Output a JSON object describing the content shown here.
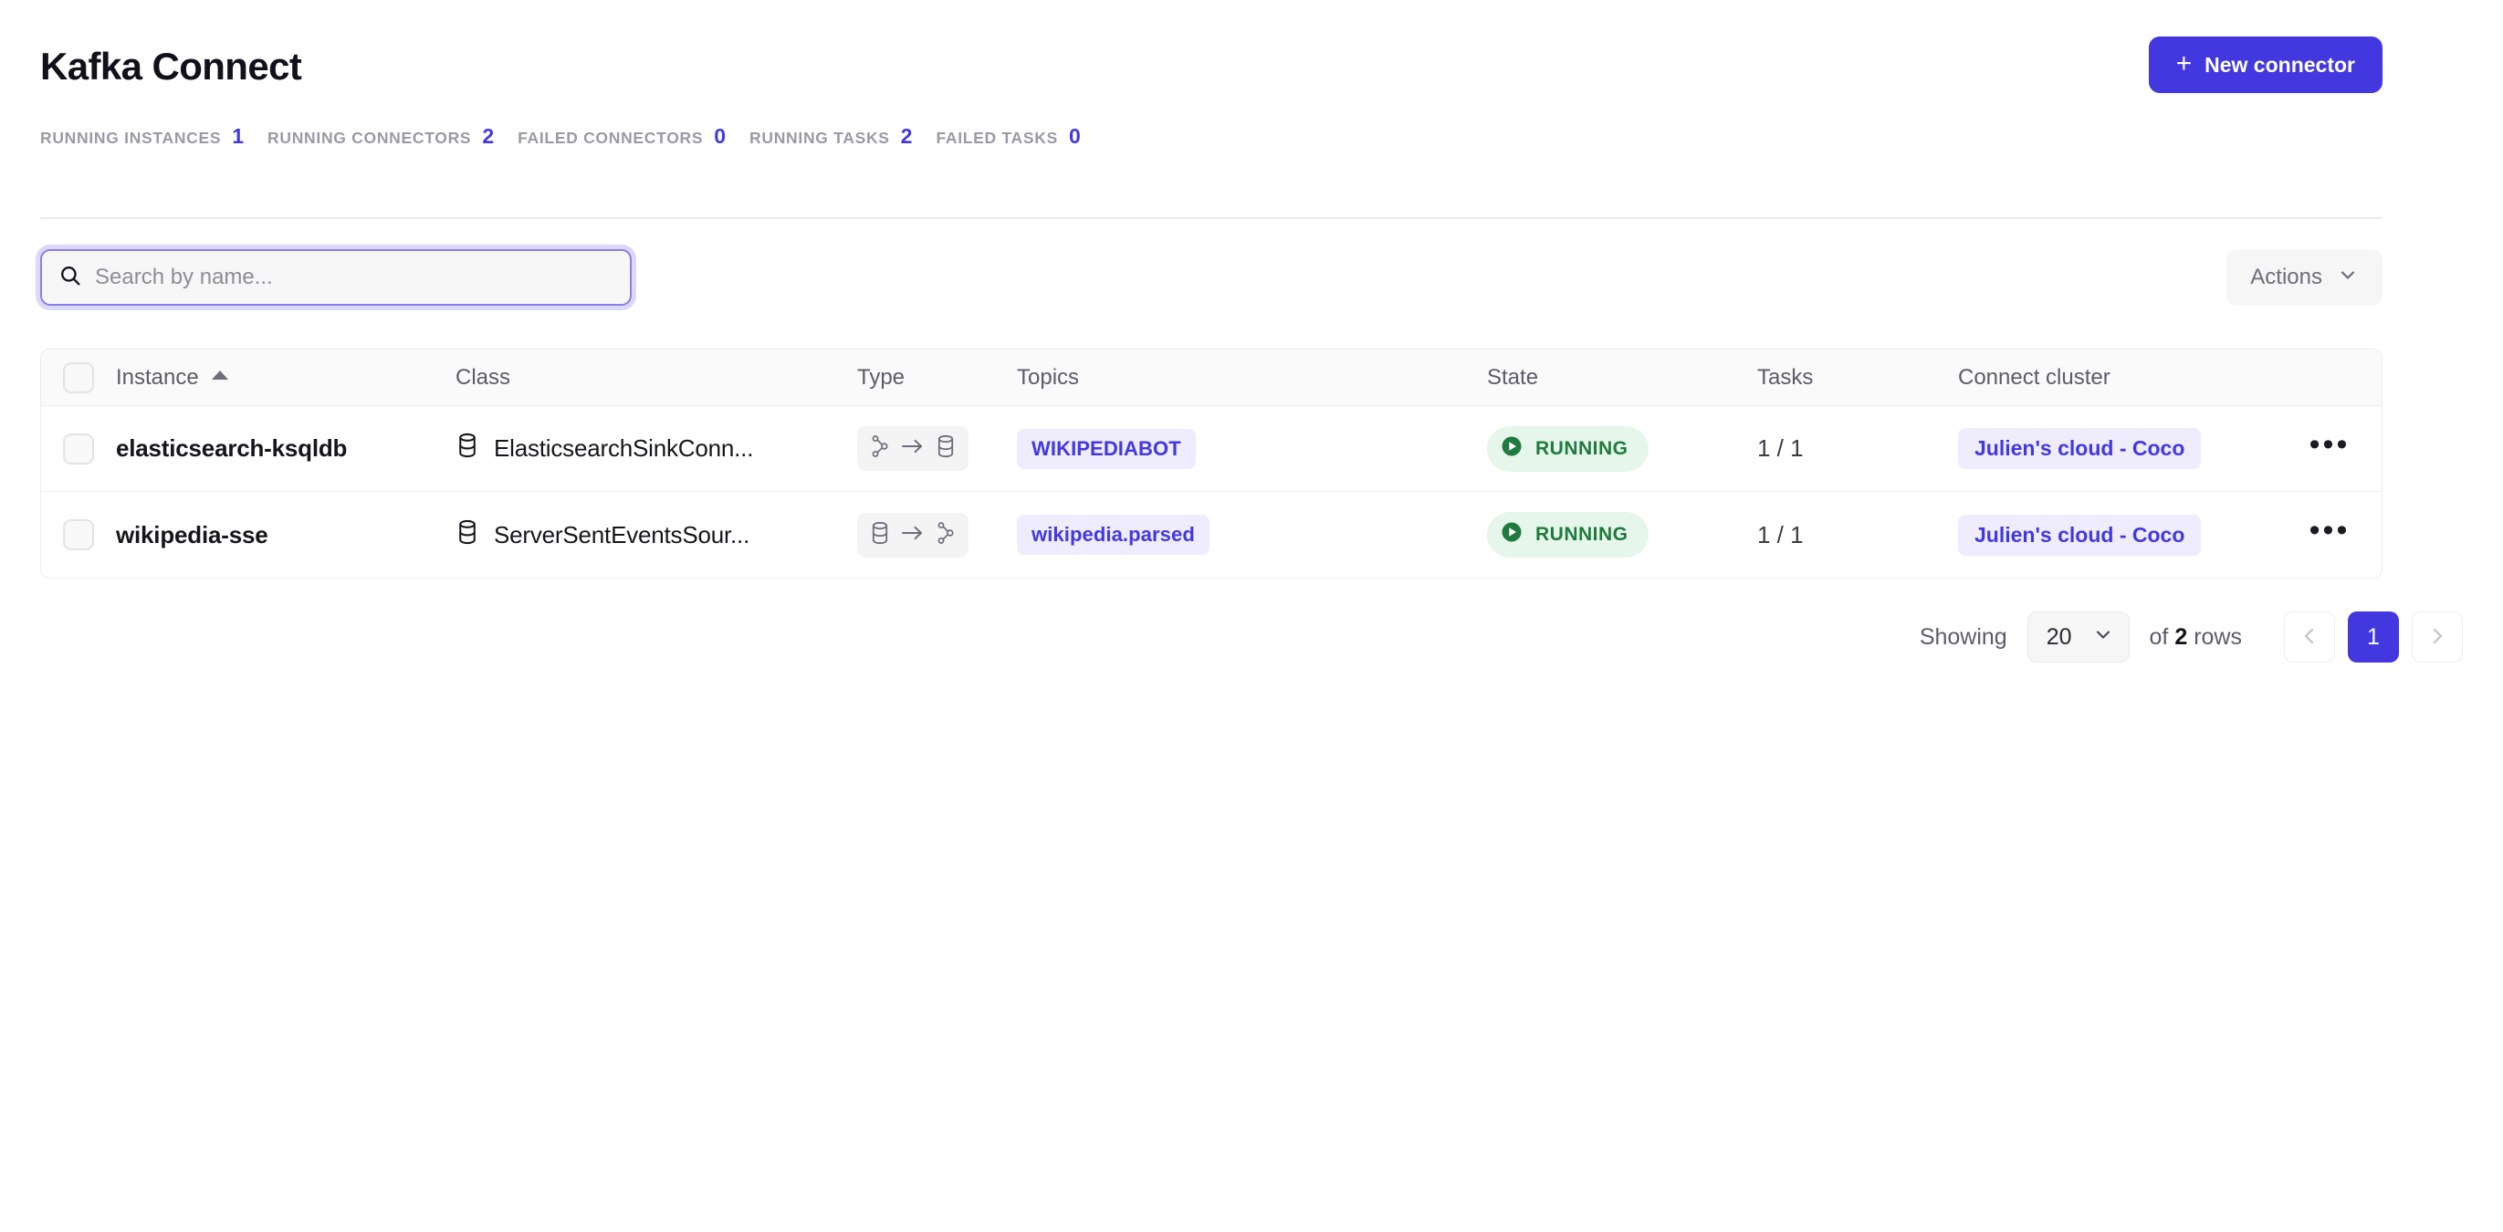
{
  "header": {
    "title": "Kafka Connect",
    "new_connector_label": "New connector",
    "plus_glyph": "+"
  },
  "stats": [
    {
      "label": "RUNNING INSTANCES",
      "value": "1"
    },
    {
      "label": "RUNNING CONNECTORS",
      "value": "2"
    },
    {
      "label": "FAILED CONNECTORS",
      "value": "0"
    },
    {
      "label": "RUNNING TASKS",
      "value": "2"
    },
    {
      "label": "FAILED TASKS",
      "value": "0"
    }
  ],
  "toolbar": {
    "search_placeholder": "Search by name...",
    "search_value": "",
    "actions_label": "Actions"
  },
  "table": {
    "columns": {
      "instance": "Instance",
      "class": "Class",
      "type": "Type",
      "topics": "Topics",
      "state": "State",
      "tasks": "Tasks",
      "cluster": "Connect cluster"
    },
    "sort": {
      "column": "Instance",
      "direction": "asc"
    },
    "rows": [
      {
        "instance": "elasticsearch-ksqldb",
        "class": "ElasticsearchSinkConn...",
        "type": "sink",
        "type_from_icon": "kafka-icon",
        "type_to_icon": "database-icon",
        "topic": "WIKIPEDIABOT",
        "state": "RUNNING",
        "tasks": "1 / 1",
        "cluster": "Julien's cloud - Coco",
        "menu": "•••"
      },
      {
        "instance": "wikipedia-sse",
        "class": "ServerSentEventsSour...",
        "type": "source",
        "type_from_icon": "database-icon",
        "type_to_icon": "kafka-icon",
        "topic": "wikipedia.parsed",
        "state": "RUNNING",
        "tasks": "1 / 1",
        "cluster": "Julien's cloud - Coco",
        "menu": "•••"
      }
    ]
  },
  "footer": {
    "showing_label": "Showing",
    "page_size": "20",
    "of_label": "of",
    "rows_count": "2",
    "rows_label": "rows",
    "current_page": "1"
  },
  "colors": {
    "accent": "#4338e0",
    "chip_bg": "#eeecfd",
    "state_bg": "#e7f6ea",
    "state_text": "#1f7a3d",
    "muted": "#9a9aa6"
  }
}
